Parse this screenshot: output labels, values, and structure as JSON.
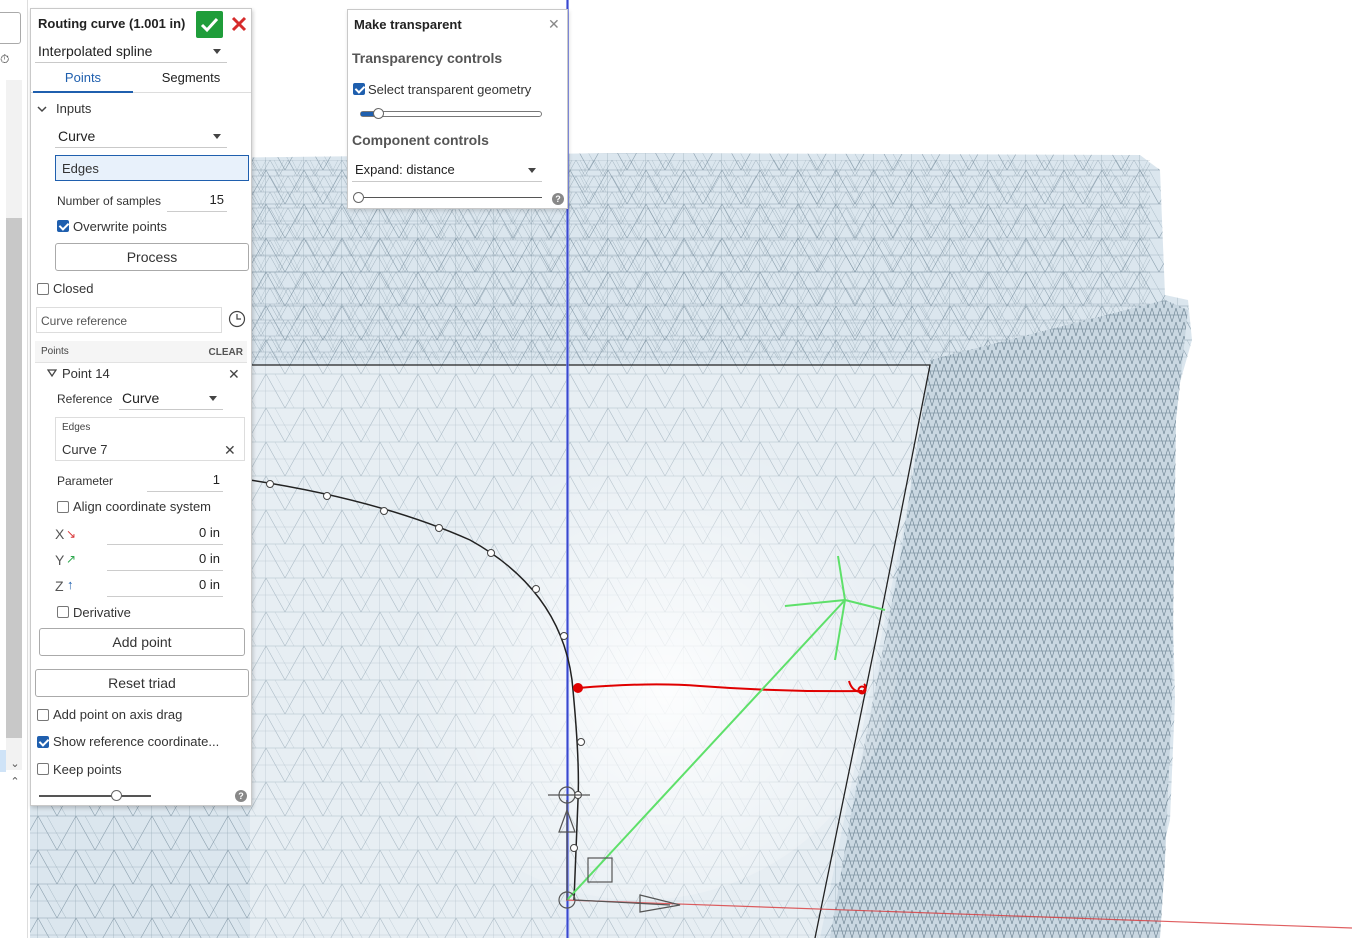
{
  "routing_dialog": {
    "title": "Routing curve (1.001 in)",
    "curve_type": "Interpolated spline",
    "tabs": [
      {
        "label": "Points",
        "active": true
      },
      {
        "label": "Segments",
        "active": false
      }
    ],
    "inputs_label": "Inputs",
    "input_type": "Curve",
    "edges_label": "Edges",
    "num_samples_label": "Number of samples",
    "num_samples_value": "15",
    "overwrite_points_label": "Overwrite points",
    "overwrite_points_checked": true,
    "process_label": "Process",
    "closed_label": "Closed",
    "closed_checked": false,
    "curve_reference_placeholder": "Curve reference",
    "points_header": "Points",
    "clear_label": "CLEAR",
    "point": {
      "label": "Point 14",
      "reference_label": "Reference",
      "reference_value": "Curve",
      "edges_label": "Edges",
      "edges_value": "Curve 7",
      "parameter_label": "Parameter",
      "parameter_value": "1",
      "align_label": "Align coordinate system",
      "align_checked": false,
      "x_label": "X",
      "x_value": "0 in",
      "y_label": "Y",
      "y_value": "0 in",
      "z_label": "Z",
      "z_value": "0 in",
      "derivative_label": "Derivative",
      "derivative_checked": false
    },
    "add_point_label": "Add point",
    "reset_triad_label": "Reset triad",
    "add_point_on_axis_drag_label": "Add point on axis drag",
    "add_point_on_axis_drag_checked": false,
    "show_reference_label": "Show reference coordinate...",
    "show_reference_checked": true,
    "keep_points_label": "Keep points",
    "keep_points_checked": false,
    "slider_level": 0.68
  },
  "transparent_dialog": {
    "title": "Make transparent",
    "transparency_header": "Transparency controls",
    "select_transparent_label": "Select transparent geometry",
    "select_transparent_checked": true,
    "transparency_level": 0.1,
    "component_header": "Component controls",
    "expand_mode": "Expand: distance",
    "expand_level": 0.0
  },
  "colors": {
    "accent": "#1f5fae",
    "ok_green": "#1f9d3a",
    "cancel_red": "#d62b2b",
    "mesh_fill": "#dbe6ee",
    "mesh_lines": "#6d8494",
    "x_axis": "#d9383a",
    "y_axis": "#2fa84f",
    "z_axis": "#1f5fae",
    "curve_red": "#e00000",
    "triad_green": "#5ee06a",
    "plane_blue": "#6a78e6"
  },
  "icons": [
    "check-icon",
    "close-icon",
    "chevron-down-icon",
    "clock-icon",
    "help-icon",
    "curve-reference-icon"
  ]
}
